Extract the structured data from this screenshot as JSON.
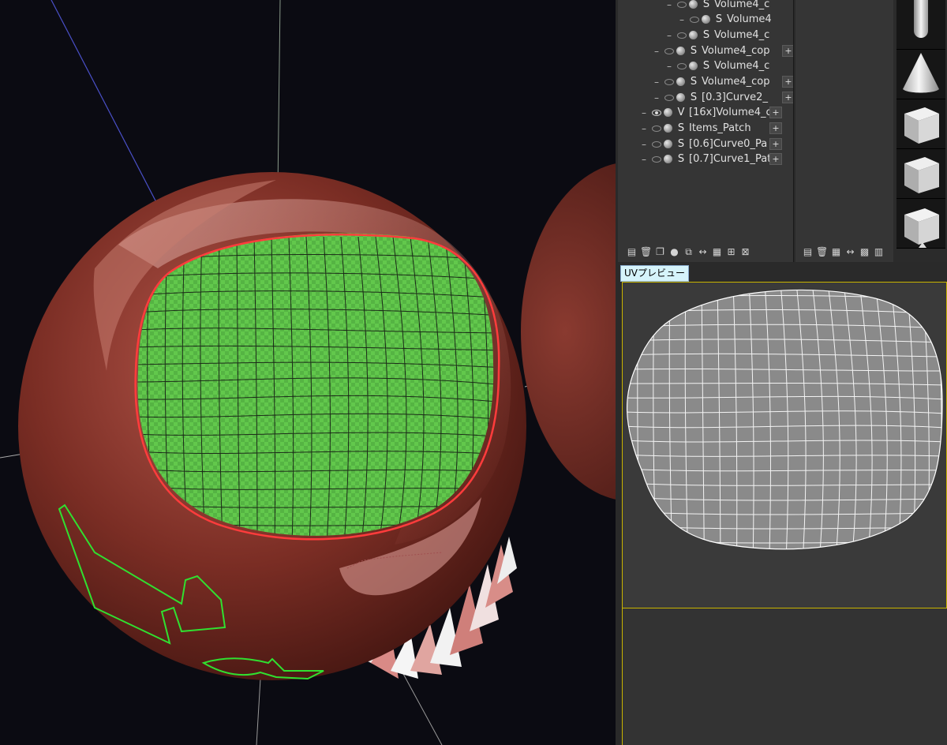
{
  "object_tree": {
    "rows": [
      {
        "indent": 2,
        "eye": "off",
        "type": "S",
        "name": "Volume4_c"
      },
      {
        "indent": 3,
        "eye": "off",
        "type": "S",
        "name": "Volume4"
      },
      {
        "indent": 2,
        "eye": "off",
        "type": "S",
        "name": "Volume4_c"
      },
      {
        "indent": 1,
        "eye": "off",
        "type": "S",
        "name": "Volume4_cop"
      },
      {
        "indent": 2,
        "eye": "off",
        "type": "S",
        "name": "Volume4_c"
      },
      {
        "indent": 1,
        "eye": "off",
        "type": "S",
        "name": "Volume4_cop"
      },
      {
        "indent": 1,
        "eye": "off",
        "type": "S",
        "name": "[0.3]Curve2_"
      },
      {
        "indent": 0,
        "eye": "on",
        "type": "V",
        "name": "[16x]Volume4_c"
      },
      {
        "indent": 0,
        "eye": "off",
        "type": "S",
        "name": "Items_Patch"
      },
      {
        "indent": 0,
        "eye": "off",
        "type": "S",
        "name": "[0.6]Curve0_Pa"
      },
      {
        "indent": 0,
        "eye": "off",
        "type": "S",
        "name": "[0.7]Curve1_Pat"
      }
    ],
    "toolbar_icons": [
      "new-object-icon",
      "trash-icon",
      "copy-icon",
      "sphere-icon",
      "duplicate-icon",
      "flip-icon",
      "grid-icon",
      "merge-icon",
      "collapse-icon"
    ]
  },
  "layer_panel": {
    "toolbar_icons": [
      "new-layer-icon",
      "trash-icon",
      "grid-icon",
      "flip-icon",
      "grid-fill-icon",
      "list-icon"
    ]
  },
  "shape_palette": {
    "shapes": [
      "capsule",
      "cone",
      "cube",
      "cube",
      "cube"
    ]
  },
  "uv_preview": {
    "tab_label": "UVプレビュー"
  },
  "colors": {
    "viewport_bg": "#0b0b12",
    "sphere": "#7a2d24",
    "patch": "#5ec44a",
    "uv_mesh": "#8a8a8a",
    "highlight": "#c8b400"
  }
}
